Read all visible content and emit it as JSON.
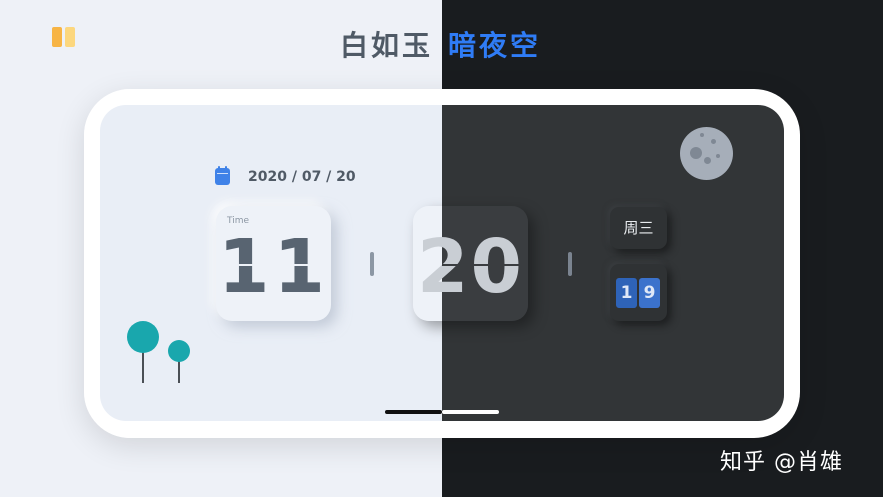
{
  "header": {
    "title_light": "白如玉",
    "title_dark": "暗夜空",
    "title_dark_color": "#2f7cf6"
  },
  "logo": {
    "icon": "theme-logo-icon",
    "colors": [
      "#f7b445",
      "#fcd77e"
    ]
  },
  "clock": {
    "date": "2020 / 07 / 20",
    "hour_label": "Time",
    "hour": "11",
    "minute": "20",
    "weekday": "周三",
    "day_digits": [
      "1",
      "9"
    ]
  },
  "theme": {
    "light_background": "#e9eef6",
    "dark_background": "#323537",
    "accent_teal": "#19a7ad"
  },
  "icons": [
    "calendar-icon",
    "moon-icon",
    "tree-icon"
  ],
  "watermark": {
    "text": "知乎 @肖雄"
  }
}
